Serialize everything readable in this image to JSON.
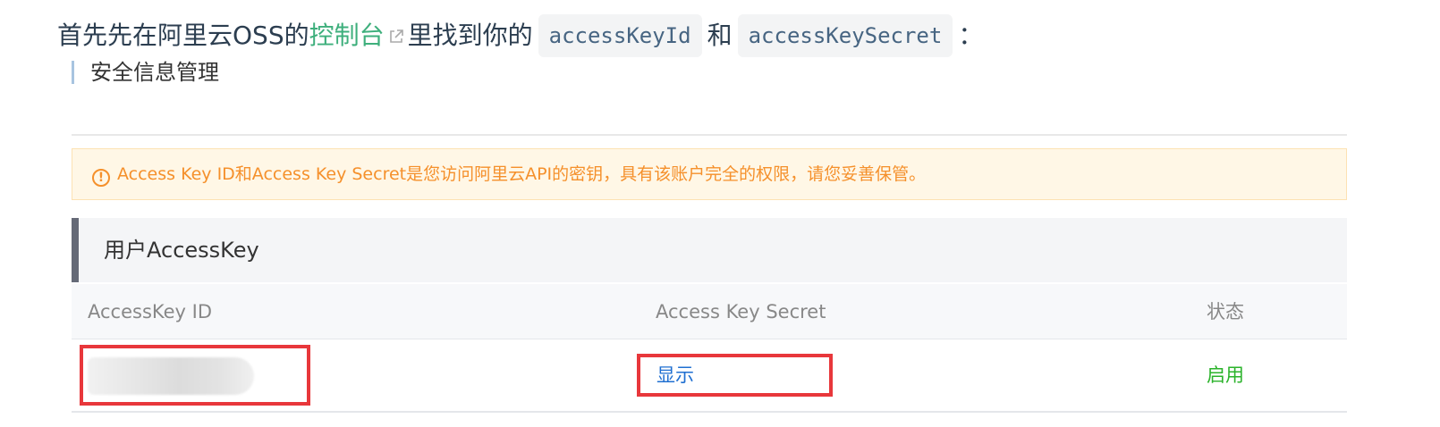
{
  "intro": {
    "before_link": "首先先在阿里云OSS的",
    "link_text": "控制台",
    "after_link": "里找到你的",
    "code1": "accessKeyId",
    "connector": "和",
    "code2": "accessKeySecret",
    "trailing": "："
  },
  "section_heading": "安全信息管理",
  "warning": {
    "icon": "exclamation-circle-icon",
    "text": "Access Key ID和Access Key Secret是您访问阿里云API的密钥，具有该账户完全的权限，请您妥善保管。"
  },
  "panel_title": "用户AccessKey",
  "table": {
    "columns": [
      "AccessKey ID",
      "Access Key Secret",
      "状态"
    ],
    "rows": [
      {
        "access_key_id": "",
        "secret_action": "显示",
        "status": "启用"
      }
    ]
  },
  "colors": {
    "link_green": "#3eaf7c",
    "warning_orange": "#f5902b",
    "action_blue": "#1f6fd1",
    "status_green": "#2bb32b",
    "highlight_red": "#e8373b"
  }
}
